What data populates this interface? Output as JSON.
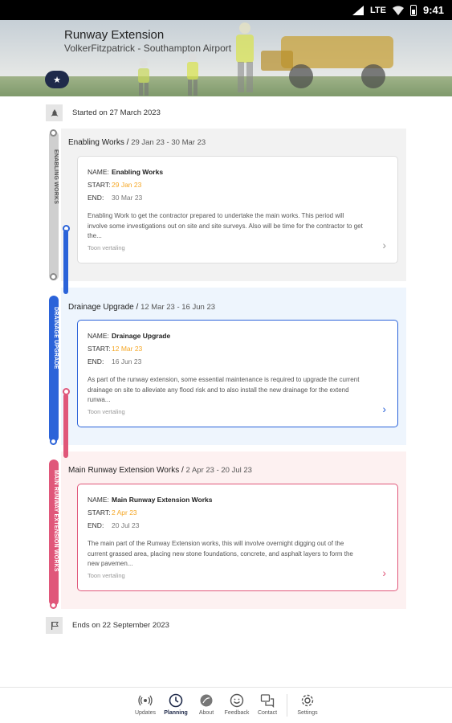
{
  "status_bar": {
    "network": "LTE",
    "time": "9:41"
  },
  "header": {
    "title": "Runway Extension",
    "subtitle": "VolkerFitzpatrick - Southampton Airport",
    "fav_icon": "star-icon"
  },
  "timeline": {
    "start_text": "Started on 27 March 2023",
    "end_text": "Ends on 22 September 2023",
    "phases": [
      {
        "track_label": "ENABLING WORKS",
        "heading": "Enabling Works /",
        "dates": "29 Jan 23 - 30 Mar 23",
        "color": "#cfcfcf",
        "bg": "#f2f2f2",
        "card": {
          "name_key": "NAME:",
          "name": "Enabling Works",
          "start_key": "START:",
          "start": "29 Jan 23",
          "end_key": "END:",
          "end": "30 Mar 23",
          "description": "Enabling Work to get the contractor prepared to undertake the main works. This period will involve some investigations out on site and site surveys. Also will be time for the contractor to get the...",
          "more": "Toon vertaling"
        }
      },
      {
        "track_label": "DRAINAGE UPGRADE",
        "heading": "Drainage Upgrade /",
        "dates": "12 Mar 23 - 16 Jun 23",
        "color": "#2b63d9",
        "bg": "#eef5fd",
        "card": {
          "name_key": "NAME:",
          "name": "Drainage Upgrade",
          "start_key": "START:",
          "start": "12 Mar 23",
          "end_key": "END:",
          "end": "16 Jun 23",
          "description": "As part of the runway extension, some essential maintenance is required to upgrade the current drainage on site to alleviate any flood risk and to also install the new drainage for the extend runwa...",
          "more": "Toon vertaling"
        }
      },
      {
        "track_label": "MAIN RUNWAY EXTENSION WORKS",
        "heading": "Main Runway Extension Works /",
        "dates": "2 Apr 23 - 20 Jul 23",
        "color": "#e0577a",
        "bg": "#fdf1f1",
        "card": {
          "name_key": "NAME:",
          "name": "Main Runway Extension Works",
          "start_key": "START:",
          "start": "2 Apr 23",
          "end_key": "END:",
          "end": "20 Jul 23",
          "description": "The main part of the Runway Extension works, this will involve overnight digging out of the current grassed area, placing new stone foundations, concrete, and asphalt layers to form the new pavemen...",
          "more": "Toon vertaling"
        }
      }
    ]
  },
  "bottom_nav": [
    {
      "label": "Updates",
      "icon": "broadcast-icon"
    },
    {
      "label": "Planning",
      "icon": "clock-icon",
      "active": true
    },
    {
      "label": "About",
      "icon": "leaf-icon"
    },
    {
      "label": "Feedback",
      "icon": "smiley-icon"
    },
    {
      "label": "Contact",
      "icon": "chat-icon"
    },
    {
      "label": "Settings",
      "icon": "gear-icon"
    }
  ]
}
